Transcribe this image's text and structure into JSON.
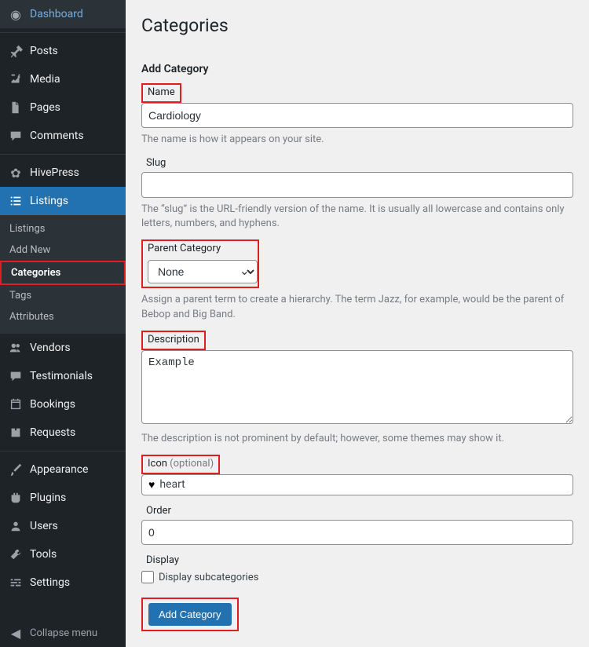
{
  "page": {
    "title": "Categories",
    "section": "Add Category"
  },
  "sidebar": {
    "dashboard": "Dashboard",
    "posts": "Posts",
    "media": "Media",
    "pages": "Pages",
    "comments": "Comments",
    "hivepress": "HivePress",
    "listings": "Listings",
    "listings_sub": {
      "listings": "Listings",
      "add_new": "Add New",
      "categories": "Categories",
      "tags": "Tags",
      "attributes": "Attributes"
    },
    "vendors": "Vendors",
    "testimonials": "Testimonials",
    "bookings": "Bookings",
    "requests": "Requests",
    "appearance": "Appearance",
    "plugins": "Plugins",
    "users": "Users",
    "tools": "Tools",
    "settings": "Settings",
    "collapse": "Collapse menu"
  },
  "form": {
    "name_label": "Name",
    "name_value": "Cardiology",
    "name_desc": "The name is how it appears on your site.",
    "slug_label": "Slug",
    "slug_value": "",
    "slug_desc": "The “slug” is the URL-friendly version of the name. It is usually all lowercase and contains only letters, numbers, and hyphens.",
    "parent_label": "Parent Category",
    "parent_value": "None",
    "parent_desc": "Assign a parent term to create a hierarchy. The term Jazz, for example, would be the parent of Bebop and Big Band.",
    "desc_label": "Description",
    "desc_value": "Example",
    "desc_desc": "The description is not prominent by default; however, some themes may show it.",
    "icon_label": "Icon",
    "icon_optional": " (optional)",
    "icon_value": "heart",
    "order_label": "Order",
    "order_value": "0",
    "display_label": "Display",
    "display_checkbox": "Display subcategories",
    "submit": "Add Category"
  }
}
